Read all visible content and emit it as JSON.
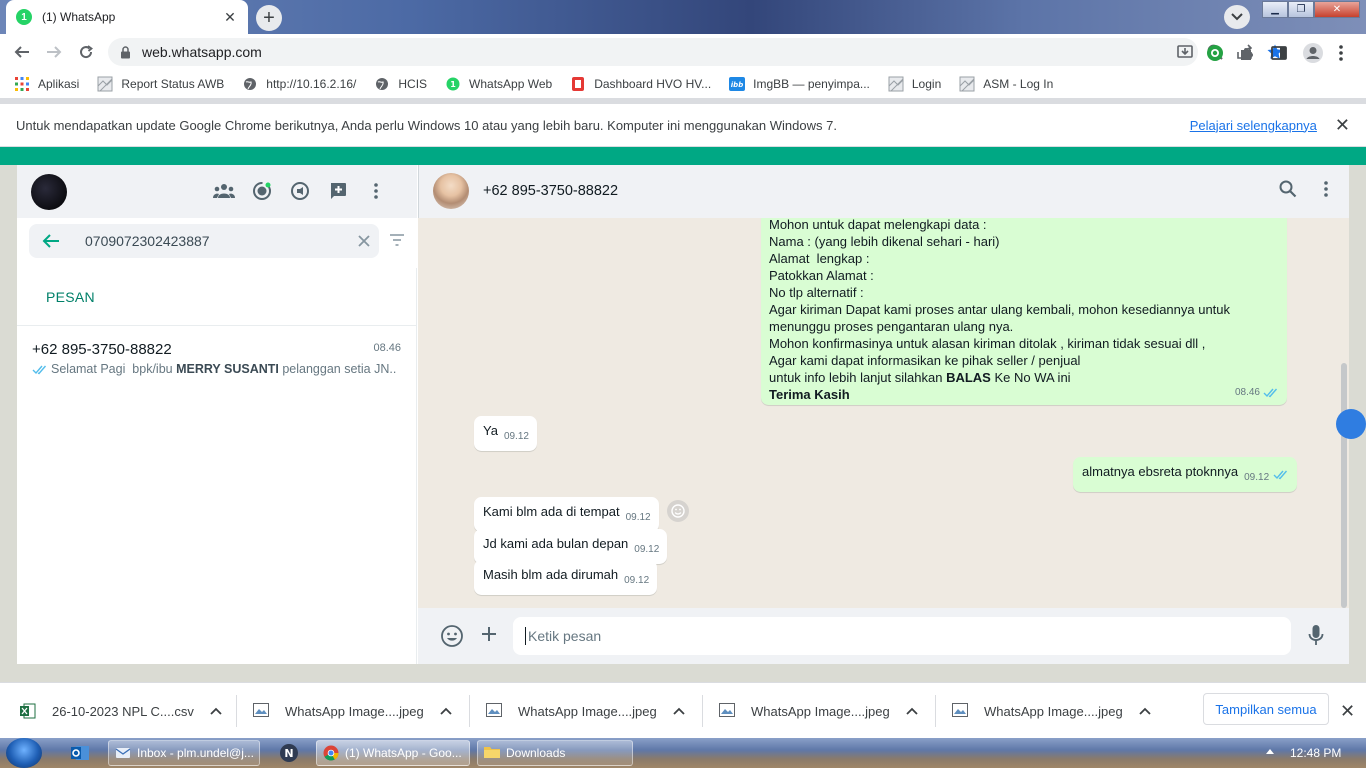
{
  "browser": {
    "tab_title": "(1) WhatsApp",
    "tab_badge": "1",
    "url": "web.whatsapp.com",
    "bookmarks": [
      {
        "label": "Aplikasi",
        "icon": "apps-grid-icon"
      },
      {
        "label": "Report Status AWB",
        "icon": "broken-page-icon"
      },
      {
        "label": "http://10.16.2.16/",
        "icon": "globe-icon"
      },
      {
        "label": "HCIS",
        "icon": "globe-icon"
      },
      {
        "label": "WhatsApp Web",
        "icon": "whatsapp-icon"
      },
      {
        "label": "Dashboard HVO HV...",
        "icon": "dashboard-icon"
      },
      {
        "label": "ImgBB — penyimpa...",
        "icon": "imgbb-icon"
      },
      {
        "label": "Login",
        "icon": "broken-page-icon"
      },
      {
        "label": "ASM - Log In",
        "icon": "broken-page-icon"
      }
    ],
    "infobar_text": "Untuk mendapatkan update Google Chrome berikutnya, Anda perlu Windows 10 atau yang lebih baru. Komputer ini menggunakan Windows 7.",
    "infobar_link": "Pelajari selengkapnya"
  },
  "whatsapp": {
    "search_value": "0709072302423887",
    "section_label": "PESAN",
    "result": {
      "name": "+62 895-3750-88822",
      "time": "08.46",
      "preview_pre": "Selamat Pagi  bpk/ibu ",
      "preview_bold": "MERRY SUSANTI",
      "preview_post": " pelanggan setia JN..."
    },
    "chat": {
      "contact_name": "+62 895-3750-88822",
      "big_message": {
        "lines": [
          "Mohon untuk dapat melengkapi data :",
          "Nama : (yang lebih dikenal sehari - hari)",
          "Alamat  lengkap :",
          "Patokkan Alamat :",
          "No tlp alternatif :",
          "Agar kiriman Dapat kami proses antar ulang kembali, mohon kesediannya untuk",
          "menunggu proses pengantaran ulang nya.",
          "Mohon konfirmasinya untuk alasan kiriman ditolak , kiriman tidak sesuai dll ,",
          "Agar kami dapat informasikan ke pihak seller / penjual"
        ],
        "last_line_pre": "untuk info lebih lanjut silahkan ",
        "last_line_bold": "BALAS",
        "last_line_post": " Ke No WA ini",
        "closing": "Terima Kasih",
        "time": "08.46"
      },
      "messages": [
        {
          "text": "Ya",
          "time": "09.12",
          "dir": "in"
        },
        {
          "text": "almatnya ebsreta ptoknnya",
          "time": "09.12",
          "dir": "out"
        },
        {
          "text": "Kami blm ada di tempat",
          "time": "09.12",
          "dir": "in"
        },
        {
          "text": "Jd kami ada bulan depan",
          "time": "09.12",
          "dir": "in"
        },
        {
          "text": "Masih blm ada dirumah",
          "time": "09.12",
          "dir": "in"
        }
      ],
      "input_placeholder": "Ketik pesan"
    },
    "colors": {
      "accent": "#00a884",
      "outgoing": "#d9fdd3",
      "ticks": "#53bdeb"
    }
  },
  "downloads": {
    "items": [
      {
        "name": "26-10-2023 NPL C....csv",
        "icon": "excel-file-icon"
      },
      {
        "name": "WhatsApp Image....jpeg",
        "icon": "image-file-icon"
      },
      {
        "name": "WhatsApp Image....jpeg",
        "icon": "image-file-icon"
      },
      {
        "name": "WhatsApp Image....jpeg",
        "icon": "image-file-icon"
      },
      {
        "name": "WhatsApp Image....jpeg",
        "icon": "image-file-icon"
      }
    ],
    "show_all": "Tampilkan semua"
  },
  "taskbar": {
    "items": [
      {
        "label": "Inbox - plm.undel@j...",
        "icon": "outlook-icon"
      },
      {
        "label": "(1) WhatsApp - Goo...",
        "icon": "chrome-icon"
      },
      {
        "label": "Downloads",
        "icon": "folder-icon"
      }
    ],
    "clock": "12:48 PM"
  }
}
